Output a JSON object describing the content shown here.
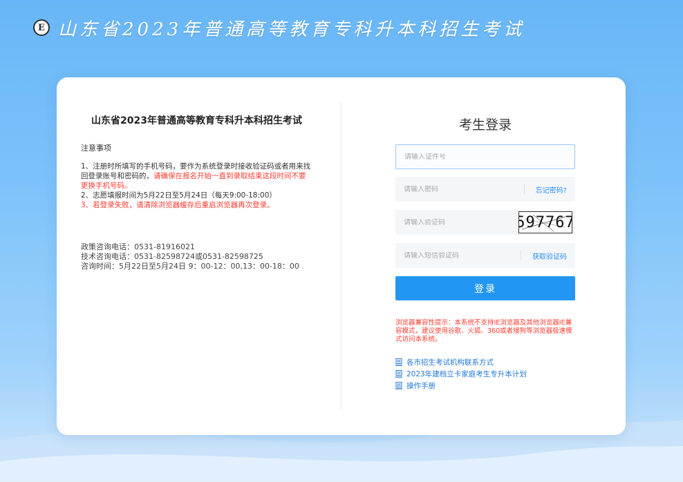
{
  "header": {
    "logo_letter": "E",
    "site_title": "山东省2023年普通高等教育专科升本科招生考试"
  },
  "left": {
    "title": "山东省2023年普通高等教育专科升本科招生考试",
    "notice_heading": "注意事项",
    "item1_black": "1、注册时所填写的手机号码，要作为系统登录时接收验证码或者用来找回登录账号和密码的，",
    "item1_red": "请确保在报名开始一直到录取结束这段时间不要更换手机号码。",
    "item2": "2、志愿填报时间为5月22日至5月24日（每天9:00-18:00）",
    "item3": "3、若登录失败，请清除浏览器缓存后重启浏览器再次登录。",
    "contact": [
      "政策咨询电话：0531-81916021",
      "技术咨询电话：0531-82598724或0531-82598725",
      "咨询时间：5月22日至5月24日 9：00-12：00,13：00-18：00"
    ]
  },
  "login": {
    "title": "考生登录",
    "id_placeholder": "请输入证件号",
    "password_placeholder": "请输入密码",
    "forgot_password": "忘记密码?",
    "captcha_placeholder": "请输入验证码",
    "captcha_text": "597767",
    "sms_placeholder": "请输入短信验证码",
    "get_code": "获取验证码",
    "submit": "登录",
    "compat_notice": "浏览器兼容性提示：本系统不支持IE浏览器及其他浏览器IE兼容模式，建议使用谷歌、火狐、360或者搜狗等浏览器极速模式访问本系统。"
  },
  "links": [
    {
      "icon": "document-icon",
      "label": "各市招生考试机构联系方式"
    },
    {
      "icon": "document-icon",
      "label": "2023年建档立卡家庭考生专升本计划"
    },
    {
      "icon": "document-icon",
      "label": "操作手册"
    }
  ]
}
